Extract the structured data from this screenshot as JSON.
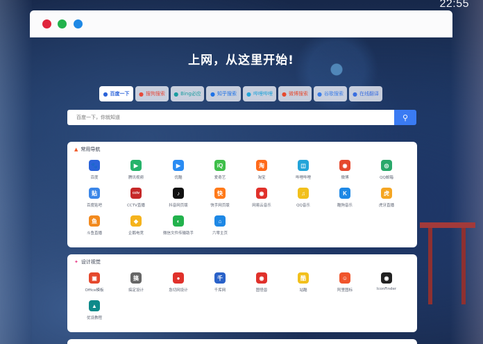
{
  "clock": "22:55",
  "headline": "上网，从这里开始!",
  "tabs": [
    {
      "label": "百度一下",
      "icon": "paw-icon",
      "color": "#2b63d9"
    },
    {
      "label": "搜狗搜索",
      "icon": "sogou-icon",
      "color": "#e64a3b"
    },
    {
      "label": "Bing必应",
      "icon": "bing-icon",
      "color": "#1a9ca0"
    },
    {
      "label": "知乎搜索",
      "icon": "zhihu-icon",
      "color": "#1e72e6"
    },
    {
      "label": "哔哩哔哩",
      "icon": "bilibili-icon",
      "color": "#23a4d9"
    },
    {
      "label": "微博搜索",
      "icon": "weibo-icon",
      "color": "#e6492e"
    },
    {
      "label": "谷歌搜索",
      "icon": "google-icon",
      "color": "#3b7de8"
    },
    {
      "label": "在线翻译",
      "icon": "translate-icon",
      "color": "#3a6fe0"
    }
  ],
  "search": {
    "placeholder": "百度一下，你就知道"
  },
  "sections": [
    {
      "title": "常用导航",
      "items": [
        {
          "label": "百度",
          "icon": "baidu-icon",
          "glyph": "🐾",
          "color": "#2b63d9"
        },
        {
          "label": "腾讯视频",
          "icon": "tencent-video-icon",
          "glyph": "▶",
          "color": "#27b36b"
        },
        {
          "label": "优酷",
          "icon": "youku-icon",
          "glyph": "▶",
          "color": "#2a8cf3"
        },
        {
          "label": "爱奇艺",
          "icon": "iqiyi-icon",
          "glyph": "iQ",
          "color": "#3fbf4a"
        },
        {
          "label": "淘宝",
          "icon": "taobao-icon",
          "glyph": "淘",
          "color": "#ff6a1a"
        },
        {
          "label": "哔哩哔哩",
          "icon": "bilibili-icon",
          "glyph": "◫",
          "color": "#23a4d9"
        },
        {
          "label": "微博",
          "icon": "weibo-icon",
          "glyph": "◉",
          "color": "#e6492e"
        },
        {
          "label": "QQ邮箱",
          "icon": "qqmail-icon",
          "glyph": "◎",
          "color": "#29a86a"
        },
        {
          "label": "百度贴吧",
          "icon": "tieba-icon",
          "glyph": "贴",
          "color": "#3b86e8"
        },
        {
          "label": "CCTV直播",
          "icon": "cctv-icon",
          "glyph": "cctv",
          "color": "#c62828"
        },
        {
          "label": "抖音网页版",
          "icon": "douyin-icon",
          "glyph": "♪",
          "color": "#111111"
        },
        {
          "label": "快手网页版",
          "icon": "kuaishou-icon",
          "glyph": "快",
          "color": "#ff7a1a"
        },
        {
          "label": "网易云音乐",
          "icon": "netease-music-icon",
          "glyph": "◉",
          "color": "#e0312b"
        },
        {
          "label": "QQ音乐",
          "icon": "qqmusic-icon",
          "glyph": "♫",
          "color": "#f2c01c"
        },
        {
          "label": "酷狗音乐",
          "icon": "kugou-icon",
          "glyph": "K",
          "color": "#1e88e5"
        },
        {
          "label": "虎牙直播",
          "icon": "huya-icon",
          "glyph": "虎",
          "color": "#f5a623"
        },
        {
          "label": "斗鱼直播",
          "icon": "douyu-icon",
          "glyph": "鱼",
          "color": "#f28a1e"
        },
        {
          "label": "企鹅电竞",
          "icon": "penguin-esports-icon",
          "glyph": "◆",
          "color": "#f5b31c"
        },
        {
          "label": "微信文件传输助手",
          "icon": "wechat-icon",
          "glyph": "◐",
          "color": "#22b24c"
        },
        {
          "label": "六零主页",
          "icon": "home-icon",
          "glyph": "⌂",
          "color": "#1e88e5"
        }
      ]
    },
    {
      "title": "设计视觉",
      "items": [
        {
          "label": "Office模板",
          "icon": "office-icon",
          "glyph": "▣",
          "color": "#e5482c"
        },
        {
          "label": "搞定设计",
          "icon": "gaoding-icon",
          "glyph": "搞",
          "color": "#666666"
        },
        {
          "label": "急切网设计",
          "icon": "jiqie-icon",
          "glyph": "●",
          "color": "#e0312b"
        },
        {
          "label": "千库网",
          "icon": "qianku-icon",
          "glyph": "千",
          "color": "#2a62c9"
        },
        {
          "label": "图怪兽",
          "icon": "tuguaishou-icon",
          "glyph": "◉",
          "color": "#e0312b"
        },
        {
          "label": "站酷",
          "icon": "zcool-icon",
          "glyph": "酷",
          "color": "#f2c01c"
        },
        {
          "label": "阿里图标",
          "icon": "iconfont-icon",
          "glyph": "☺",
          "color": "#f0552c"
        },
        {
          "label": "IconFinder",
          "icon": "eye-icon",
          "glyph": "◉",
          "color": "#222222"
        },
        {
          "label": "优设教程",
          "icon": "youshe-icon",
          "glyph": "▲",
          "color": "#0e8a8a"
        }
      ]
    }
  ]
}
